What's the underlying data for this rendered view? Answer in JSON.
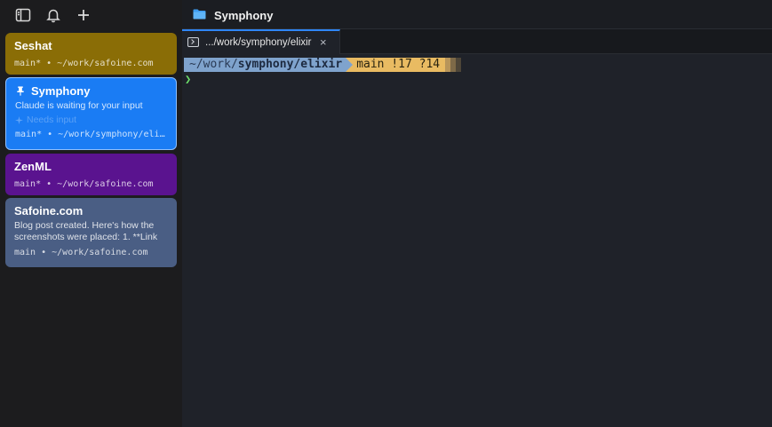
{
  "sidebar": {
    "toolbar": {
      "toggle_icon": "sidebar-toggle-icon",
      "bell_icon": "bell-icon",
      "add_icon": "plus-icon"
    },
    "sessions": [
      {
        "title": "Seshat",
        "meta": "main* • ~/work/safoine.com",
        "color": "#8a6d06"
      },
      {
        "title": "Symphony",
        "pinned": true,
        "desc": "Claude is waiting for your input",
        "status": "Needs input",
        "meta": "main* • ~/work/symphony/elixir",
        "color": "#1a7cf4"
      },
      {
        "title": "ZenML",
        "meta": "main* • ~/work/safoine.com",
        "color": "#5a138f"
      },
      {
        "title": "Safoine.com",
        "desc": "Blog post created. Here's how the screenshots were placed: 1. **Link",
        "meta": "main • ~/work/safoine.com",
        "color": "#4a5e84"
      }
    ]
  },
  "window": {
    "title": "Symphony"
  },
  "tabs": [
    {
      "label": ".../work/symphony/elixir",
      "close": "×"
    }
  ],
  "terminal": {
    "path_prefix": "~/work/",
    "path_bold": "symphony/elixir",
    "git_status": "main !17 ?14",
    "prompt_char": "❯"
  }
}
